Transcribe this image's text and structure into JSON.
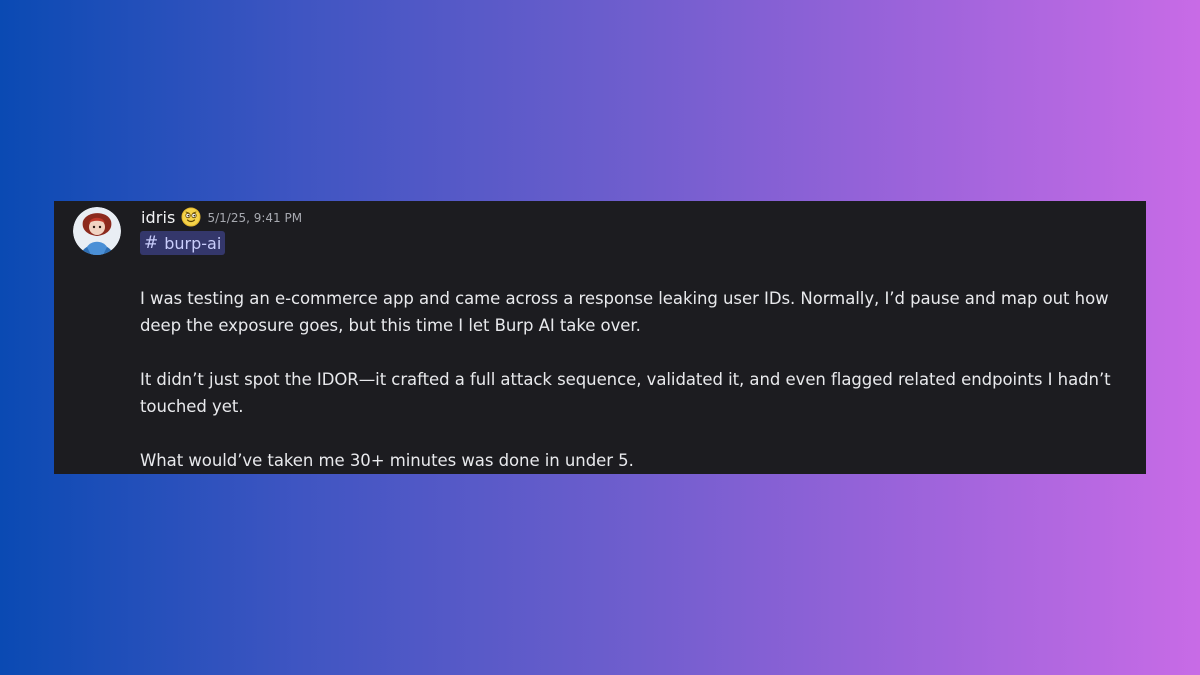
{
  "message": {
    "username": "idris",
    "timestamp": "5/1/25, 9:41 PM",
    "channel": {
      "hash": "#",
      "name": "burp-ai"
    },
    "paragraphs": [
      "I was testing an e-commerce app and came across a response leaking user IDs. Normally, I’d pause and map out how\ndeep the exposure goes, but this time I let Burp AI take over.",
      "It didn’t just spot the IDOR—it crafted a full attack sequence, validated it, and even flagged related endpoints I hadn’t\ntouched yet.",
      "What would’ve taken me 30+ minutes was done in under 5."
    ]
  },
  "icons": {
    "avatar": "user-avatar",
    "badge": "emoji-badge-icon"
  },
  "colors": {
    "card_background": "#1c1c20",
    "mention_background": "#34376b",
    "mention_text": "#c9cdfb",
    "gradient_start": "#0a4ab3",
    "gradient_end": "#c86be6"
  }
}
